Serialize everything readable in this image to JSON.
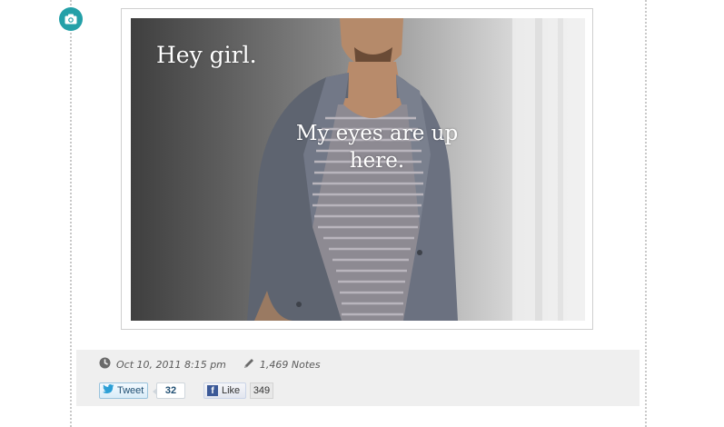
{
  "post": {
    "image_caption_top": "Hey girl.",
    "image_caption_middle": "My eyes are up here.",
    "date": "Oct 10, 2011 8:15 pm",
    "notes": "1,469 Notes"
  },
  "social": {
    "tweet_label": "Tweet",
    "tweet_count": "32",
    "like_label": "Like",
    "like_count": "349"
  },
  "icons": {
    "post_type": "camera-icon",
    "date": "clock-icon",
    "notes": "pencil-icon",
    "tweet": "twitter-bird-icon",
    "like": "facebook-icon"
  },
  "colors": {
    "badge": "#23a0a8",
    "meta_bar": "#efefef",
    "twitter_text": "#1f4e72",
    "facebook": "#3b5998"
  }
}
